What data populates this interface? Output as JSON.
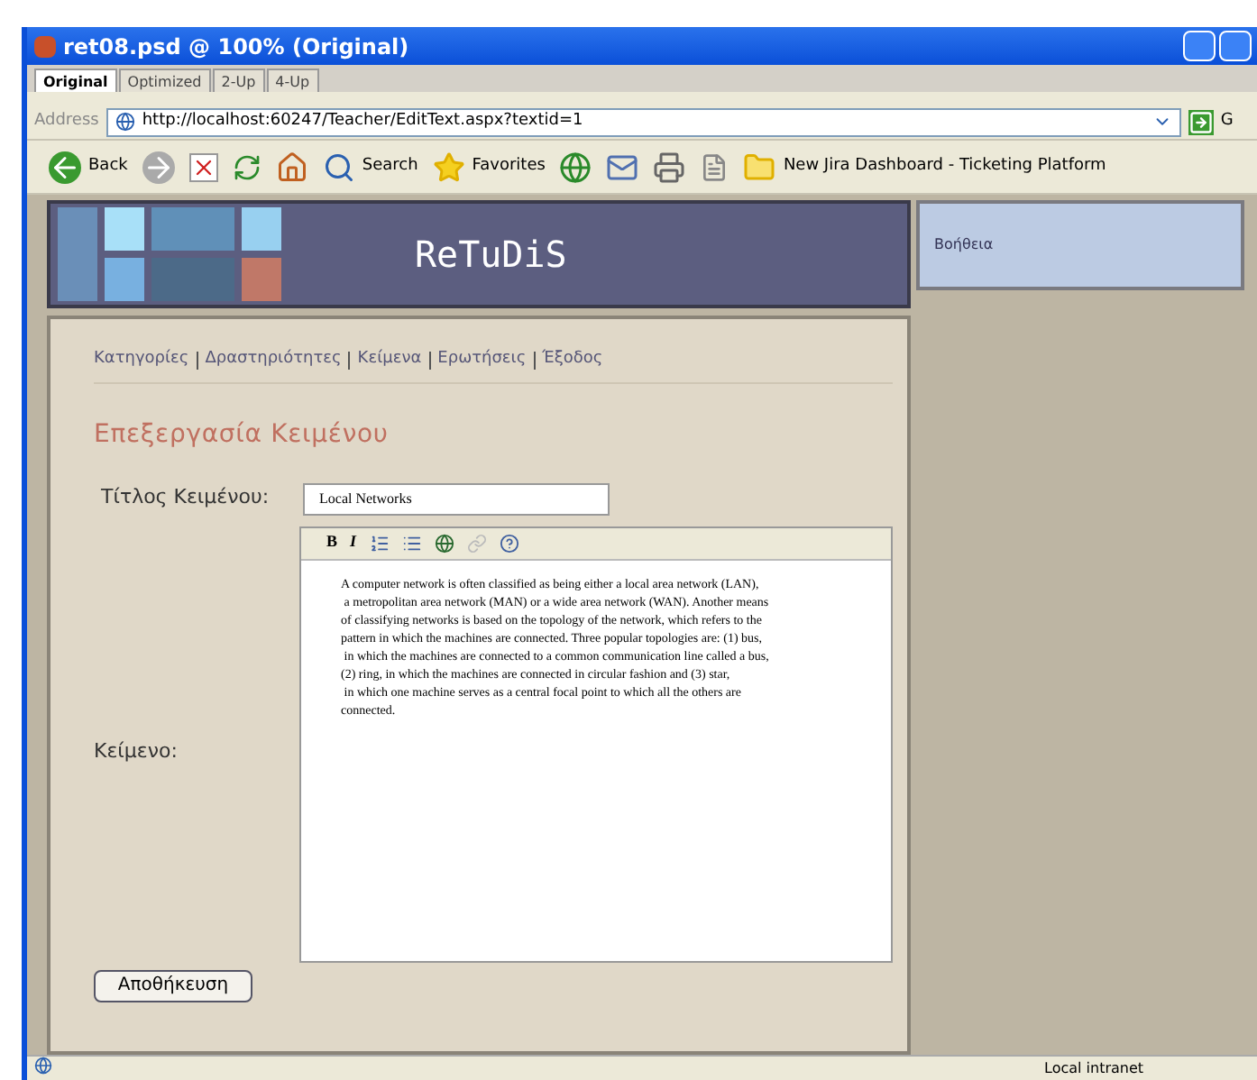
{
  "window": {
    "title": "ret08.psd @ 100% (Original)"
  },
  "tabs": [
    {
      "label": "Original",
      "selected": true
    },
    {
      "label": "Optimized",
      "selected": false
    },
    {
      "label": "2-Up",
      "selected": false
    },
    {
      "label": "4-Up",
      "selected": false
    }
  ],
  "address_bar": {
    "label": "Address",
    "value": "http://localhost:60247/Teacher/EditText.aspx?textid=1",
    "go": "G"
  },
  "toolbar": {
    "back": "Back",
    "search": "Search",
    "favorites": "Favorites",
    "link": "New Jira Dashboard - Ticketing Platform"
  },
  "header": {
    "logo_text": "ReTuDiS",
    "help": "Βοήθεια"
  },
  "nav": [
    "Κατηγορίες",
    "Δραστηριότητες",
    "Κείμενα",
    "Ερωτήσεις",
    "Έξοδος"
  ],
  "page_title": "Επεξεργασία Κειμένου",
  "form": {
    "title_label": "Τίτλος Κειμένου:",
    "title_value": "Local Networks",
    "text_label": "Κείμενο:",
    "toolbar": {
      "bold": "B",
      "italic": "I"
    },
    "text_lines": [
      "A computer network is often classified as being either a local area network (LAN),",
      " a metropolitan area network (MAN) or a wide area network (WAN). Another means",
      "of classifying networks is based on the topology of the network, which refers to the",
      "pattern in which the machines are connected. Three popular topologies are: (1) bus,",
      " in which the machines are connected to a common communication line called a bus,",
      "(2) ring, in which the machines are connected in circular fashion and (3) star,",
      " in which one machine serves as a central focal point to which all the others are",
      "connected."
    ],
    "save_button": "Αποθήκευση"
  },
  "status_bar": {
    "zone": "Local intranet"
  }
}
